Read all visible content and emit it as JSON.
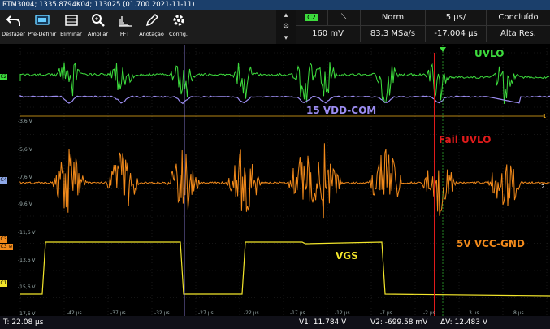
{
  "window": {
    "title": "RTM3004; 1335.8794K04; 113025 (01.700 2021-11-11)"
  },
  "toolbar": {
    "items": [
      {
        "label": "Desfazer",
        "icon": "undo-icon"
      },
      {
        "label": "Pré-Definir",
        "icon": "preset-icon"
      },
      {
        "label": "Eliminar",
        "icon": "delete-icon"
      },
      {
        "label": "Ampliar",
        "icon": "zoom-icon"
      },
      {
        "label": "FFT",
        "icon": "fft-icon"
      },
      {
        "label": "Anotação",
        "icon": "annotation-icon"
      },
      {
        "label": "Config.",
        "icon": "settings-gear-icon"
      }
    ]
  },
  "status": {
    "channel": "C2",
    "trigger_mode": "Norm",
    "timebase": "5 µs/",
    "acquisition_state": "Concluído",
    "trigger_level": "160 mV",
    "sample_rate": "83.3 MSa/s",
    "trigger_position": "-17.004 µs",
    "resolution": "Alta Res."
  },
  "annotations": {
    "uvlo": "UVLO",
    "vdd_com": "15 VDD-COM",
    "fail_uvlo": "Fail UVLO",
    "vcc_gnd": "5V VCC-GND",
    "vgs": "VGS"
  },
  "channel_tags": {
    "c2": "C2",
    "c4": "C4",
    "c3": "C3",
    "c3b": "C3 ⊘",
    "c1": "C1"
  },
  "y_ticks": [
    "-3,6 V",
    "-5,6 V",
    "-7,6 V",
    "-9,6 V",
    "-11,6 V",
    "-13,6 V",
    "-15,6 V",
    "-17,6 V"
  ],
  "x_ticks": [
    "-42 µs",
    "-37 µs",
    "-32 µs",
    "-27 µs",
    "-22 µs",
    "-17 µs",
    "-12 µs",
    "-7 µs",
    "-2 µs",
    "3 µs",
    "8 µs"
  ],
  "markers": {
    "ref1": "1",
    "ref2": "2"
  },
  "bottom": {
    "time_readout": "T: 22.08 µs",
    "v1": "V1: 11.784 V",
    "v2": "V2: -699.58 mV",
    "dv": "ΔV: 12.483 V"
  },
  "colors": {
    "c1": "#f2e52b",
    "c2": "#3ddc3d",
    "c3": "#f28a1b",
    "c4": "#f28a1b",
    "math": "#9b8cf0",
    "fail": "#e11b1b"
  }
}
